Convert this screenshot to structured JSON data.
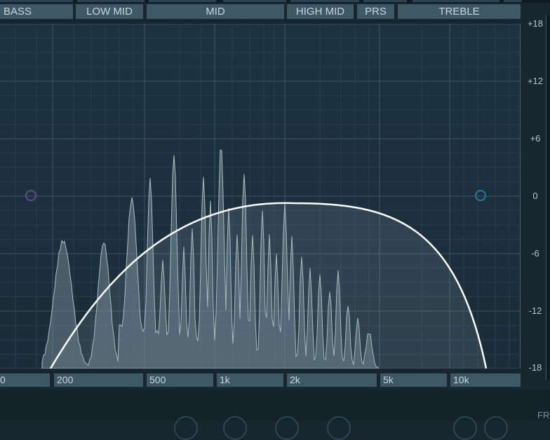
{
  "bands": [
    "BASS",
    "LOW MID",
    "MID",
    "HIGH MID",
    "PRS",
    "TREBLE"
  ],
  "db_scale": [
    "+18",
    "+12",
    "+6",
    "0",
    "-6",
    "-12",
    "-18"
  ],
  "freq_scale": [
    "0",
    "200",
    "500",
    "1k",
    "2k",
    "5k",
    "10k"
  ],
  "bottom_label": "FR",
  "colors": {
    "background": "#17262f",
    "graph": "#1d3240",
    "label_bg": "#3f5866",
    "label_text": "#c9d6dc",
    "curve": "#ffffff",
    "spectrum_fill": "#6f8590",
    "low_handle": "#5a4a8a",
    "high_handle": "#2f6f95"
  },
  "icons": {
    "low_handle": "circle-handle-icon",
    "high_handle": "circle-handle-icon"
  }
}
